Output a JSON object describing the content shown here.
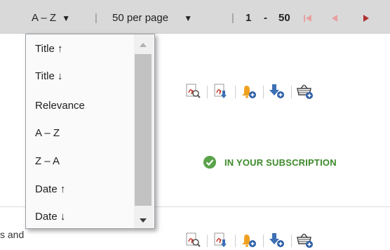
{
  "toolbar": {
    "sort_label": "A – Z",
    "sort_arrow": "▼",
    "sep": "|",
    "per_page_label": "50 per page",
    "per_page_arrow": "▼",
    "range_start": "1",
    "range_dash": "-",
    "range_end": "50"
  },
  "sort_dropdown": {
    "options": [
      "Title ↑",
      "Title ↓",
      "Relevance",
      "A – Z",
      "Z – A",
      "Date ↑",
      "Date ↓"
    ]
  },
  "result": {
    "subscription_text": "IN YOUR SUBSCRIPTION",
    "cut_text": "s and"
  },
  "colors": {
    "toolbar_bg": "#d9d9d9",
    "pdf_red": "#c0392b",
    "bell_orange": "#f0a020",
    "download_blue": "#3d6fb5",
    "subscription_green": "#3d8a2a",
    "pager_red": "#c0392b"
  },
  "icons": [
    "pdf-preview-icon",
    "pdf-download-icon",
    "alert-add-icon",
    "download-add-icon",
    "basket-add-icon",
    "checkmark-icon"
  ]
}
